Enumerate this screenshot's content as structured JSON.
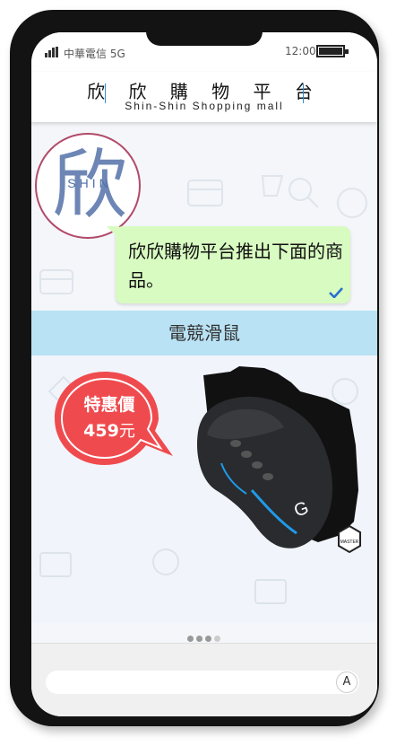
{
  "status_bar": {
    "carrier": "中華電信 5G",
    "time": "12:00"
  },
  "header": {
    "title_zh": "欣 欣 購 物 平 台",
    "title_en": "Shin-Shin Shopping mall"
  },
  "avatar": {
    "glyph": "欣",
    "text": "SHIN"
  },
  "message": {
    "text": "欣欣購物平台推出下面的商品。"
  },
  "product": {
    "category": "電競滑鼠",
    "badge_title": "特惠價",
    "price": "459",
    "currency": "元",
    "brand_tag": "MASTER"
  },
  "carousel": {
    "page_count": 4,
    "active_page": 1
  },
  "composer": {
    "input_value": "",
    "keyboard_toggle": "A"
  },
  "colors": {
    "accent_blue": "#2a8fd8",
    "bubble_green": "#d8fbc1",
    "banner_blue": "#b9e2f4",
    "badge_red": "#ef4b4f"
  }
}
